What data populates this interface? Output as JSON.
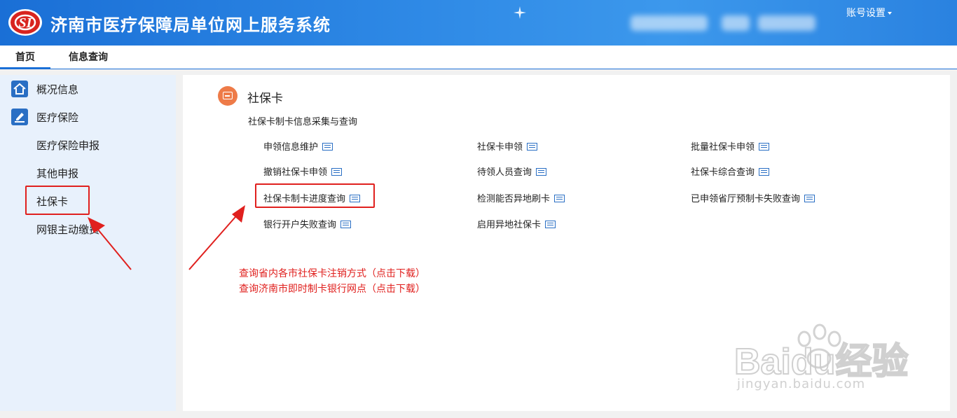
{
  "header": {
    "title": "济南市医疗保障局单位网上服务系统",
    "logo_text": "SI",
    "account_label": "账号设置"
  },
  "nav": {
    "tabs": [
      {
        "label": "首页",
        "active": true
      },
      {
        "label": "信息查询",
        "active": false
      }
    ]
  },
  "sidebar": {
    "items": [
      {
        "label": "概况信息",
        "icon": "home-icon"
      },
      {
        "label": "医疗保险",
        "icon": "edit-icon"
      },
      {
        "label": "医疗保险申报"
      },
      {
        "label": "其他申报"
      },
      {
        "label": "社保卡",
        "highlighted": true
      },
      {
        "label": "网银主动缴费"
      }
    ]
  },
  "main": {
    "section_title": "社保卡",
    "subtitle": "社保卡制卡信息采集与查询",
    "links": [
      [
        "申领信息维护",
        "社保卡申领",
        "批量社保卡申领"
      ],
      [
        "撤销社保卡申领",
        "待领人员查询",
        "社保卡综合查询"
      ],
      [
        "社保卡制卡进度查询",
        "检测能否异地刷卡",
        "已申领省厅预制卡失败查询"
      ],
      [
        "银行开户失败查询",
        "启用异地社保卡",
        ""
      ]
    ],
    "downloads": [
      "查询省内各市社保卡注销方式（点击下载）",
      "查询济南市即时制卡银行网点（点击下载）"
    ]
  },
  "watermark": {
    "text": "jingyan.baidu.com",
    "brand": "Baidu经验"
  },
  "colors": {
    "header_blue": "#1a6fd6",
    "highlight_red": "#e0201e",
    "section_orange": "#ee7b48",
    "sidebar_bg": "#e8f1fc"
  }
}
